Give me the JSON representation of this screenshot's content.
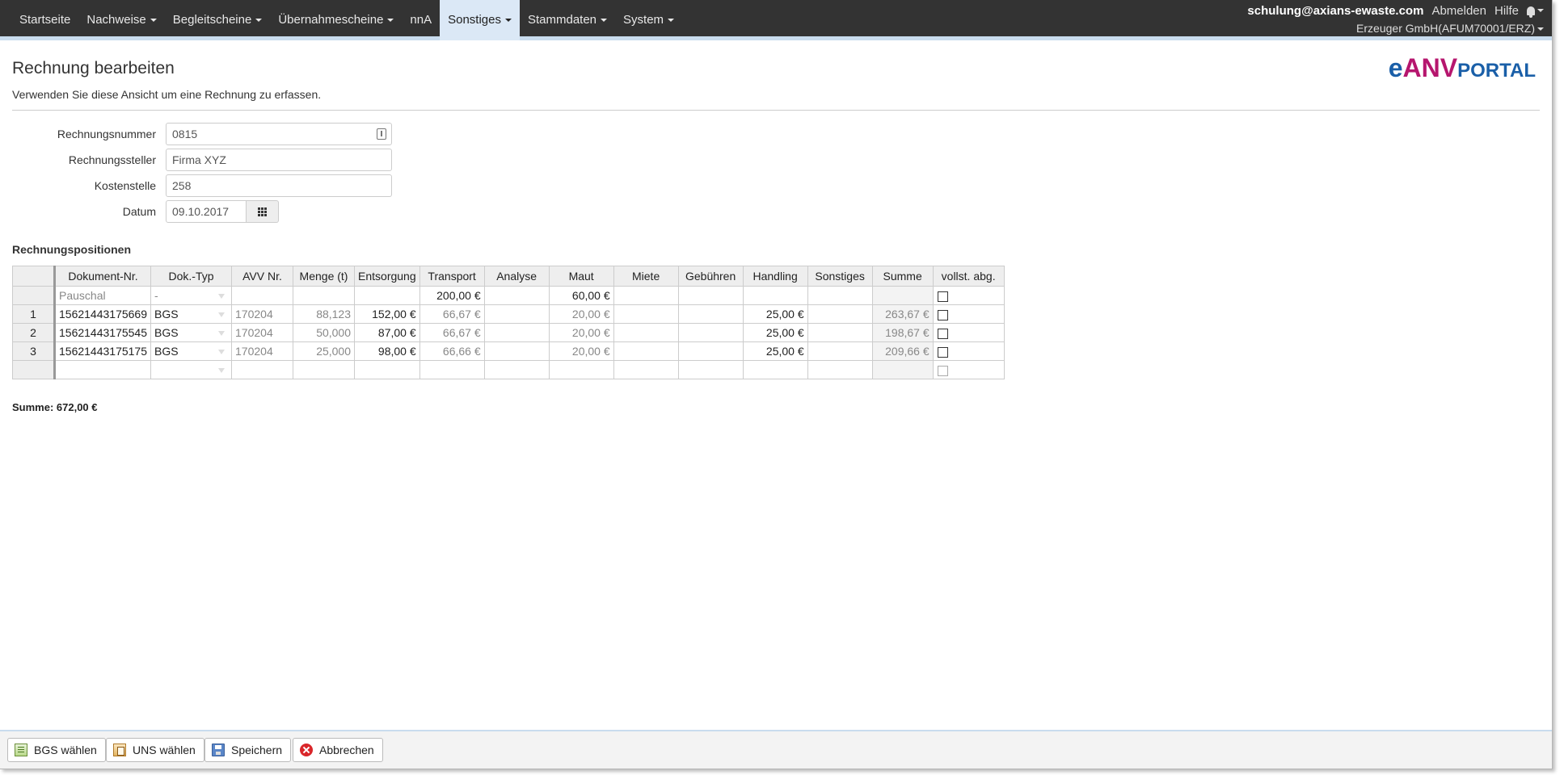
{
  "nav": {
    "items": [
      {
        "label": "Startseite",
        "dropdown": false,
        "active": false
      },
      {
        "label": "Nachweise",
        "dropdown": true,
        "active": false
      },
      {
        "label": "Begleitscheine",
        "dropdown": true,
        "active": false
      },
      {
        "label": "Übernahmescheine",
        "dropdown": true,
        "active": false
      },
      {
        "label": "nnA",
        "dropdown": false,
        "active": false
      },
      {
        "label": "Sonstiges",
        "dropdown": true,
        "active": true
      },
      {
        "label": "Stammdaten",
        "dropdown": true,
        "active": false
      },
      {
        "label": "System",
        "dropdown": true,
        "active": false
      }
    ],
    "user": "schulung@axians-ewaste.com",
    "logout": "Abmelden",
    "help": "Hilfe",
    "company": "Erzeuger GmbH(AFUM70001/ERZ)"
  },
  "header": {
    "title": "Rechnung bearbeiten",
    "subtitle": "Verwenden Sie diese Ansicht um eine Rechnung zu erfassen.",
    "logo": {
      "part1": "e",
      "part2": "ANV",
      "part3": "PORTAL"
    }
  },
  "form": {
    "rechnungsnummer": {
      "label": "Rechnungsnummer",
      "value": "0815"
    },
    "rechnungssteller": {
      "label": "Rechnungssteller",
      "value": "Firma XYZ"
    },
    "kostenstelle": {
      "label": "Kostenstelle",
      "value": "258"
    },
    "datum": {
      "label": "Datum",
      "value": "09.10.2017"
    }
  },
  "table": {
    "title": "Rechnungspositionen",
    "columns": [
      "Dokument-Nr.",
      "Dok.-Typ",
      "AVV Nr.",
      "Menge (t)",
      "Entsorgung",
      "Transport",
      "Analyse",
      "Maut",
      "Miete",
      "Gebühren",
      "Handling",
      "Sonstiges",
      "Summe",
      "vollst. abg."
    ],
    "pauschal": {
      "dokument": "Pauschal",
      "typ": "-",
      "avv": "",
      "menge": "",
      "entsorgung": "",
      "transport": "200,00 €",
      "analyse": "",
      "maut": "60,00 €",
      "miete": "",
      "gebuehren": "",
      "handling": "",
      "sonstiges": "",
      "summe": ""
    },
    "rows": [
      {
        "nr": "1",
        "dokument": "15621443175669",
        "typ": "BGS",
        "avv": "170204",
        "menge": "88,123",
        "entsorgung": "152,00 €",
        "transport": "66,67 €",
        "analyse": "",
        "maut": "20,00 €",
        "miete": "",
        "gebuehren": "",
        "handling": "25,00 €",
        "sonstiges": "",
        "summe": "263,67 €"
      },
      {
        "nr": "2",
        "dokument": "15621443175545",
        "typ": "BGS",
        "avv": "170204",
        "menge": "50,000",
        "entsorgung": "87,00 €",
        "transport": "66,67 €",
        "analyse": "",
        "maut": "20,00 €",
        "miete": "",
        "gebuehren": "",
        "handling": "25,00 €",
        "sonstiges": "",
        "summe": "198,67 €"
      },
      {
        "nr": "3",
        "dokument": "15621443175175",
        "typ": "BGS",
        "avv": "170204",
        "menge": "25,000",
        "entsorgung": "98,00 €",
        "transport": "66,66 €",
        "analyse": "",
        "maut": "20,00 €",
        "miete": "",
        "gebuehren": "",
        "handling": "25,00 €",
        "sonstiges": "",
        "summe": "209,66 €"
      }
    ]
  },
  "summe": "Summe: 672,00 €",
  "footer": {
    "bgs": "BGS wählen",
    "uns": "UNS wählen",
    "save": "Speichern",
    "cancel": "Abbrechen"
  }
}
